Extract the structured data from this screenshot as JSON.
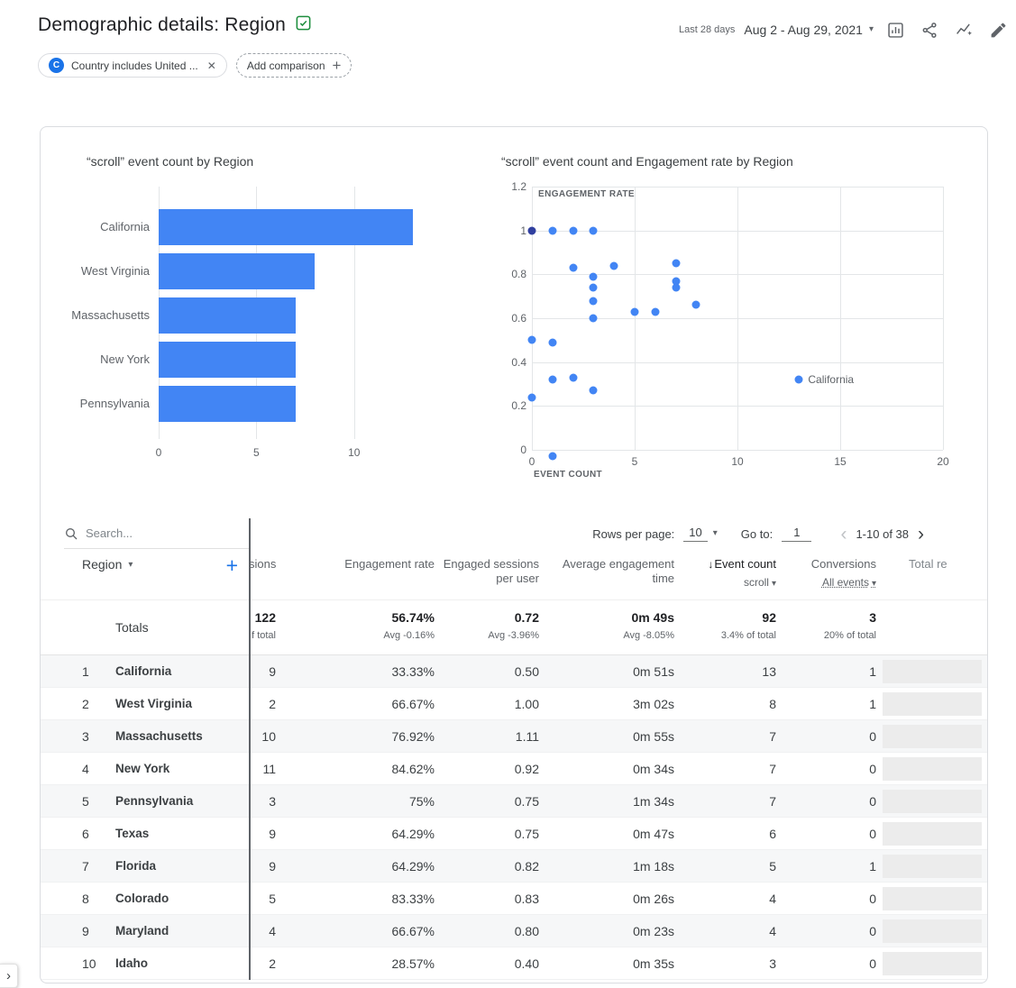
{
  "header": {
    "title": "Demographic details: Region",
    "date_range_label": "Last 28 days",
    "date_range": "Aug 2 - Aug 29, 2021"
  },
  "comparison": {
    "chip_badge": "C",
    "chip_label": "Country includes United ...",
    "add_label": "Add comparison"
  },
  "glyphs": {
    "caret_down": "▾",
    "close": "✕",
    "plus": "+",
    "chevron_left": "‹",
    "chevron_right": "›",
    "sort_desc": "↓",
    "nav_expand": "›"
  },
  "chart_data": [
    {
      "type": "bar",
      "orientation": "horizontal",
      "title": "“scroll” event count by Region",
      "categories": [
        "California",
        "West Virginia",
        "Massachusetts",
        "New York",
        "Pennsylvania"
      ],
      "values": [
        13,
        8,
        7,
        7,
        7
      ],
      "x_ticks": [
        0,
        5,
        10
      ],
      "xlim": [
        0,
        14.3
      ],
      "bar_color": "#4285f4"
    },
    {
      "type": "scatter",
      "title": "“scroll” event count and Engagement rate by Region",
      "xlabel": "EVENT COUNT",
      "ylabel": "ENGAGEMENT RATE",
      "x_ticks": [
        0,
        5,
        10,
        15,
        20
      ],
      "y_ticks": [
        0,
        0.2,
        0.4,
        0.6,
        0.8,
        1,
        1.2
      ],
      "xlim": [
        0,
        20
      ],
      "ylim": [
        0,
        1.2
      ],
      "point_color": "#4285f4",
      "points": [
        {
          "x": 0,
          "y": 1.0,
          "color": "#303f9f"
        },
        {
          "x": 1,
          "y": 1.0
        },
        {
          "x": 2,
          "y": 1.0
        },
        {
          "x": 3,
          "y": 1.0
        },
        {
          "x": 2,
          "y": 0.83
        },
        {
          "x": 4,
          "y": 0.84
        },
        {
          "x": 3,
          "y": 0.79
        },
        {
          "x": 3,
          "y": 0.74
        },
        {
          "x": 3,
          "y": 0.68
        },
        {
          "x": 3,
          "y": 0.6
        },
        {
          "x": 5,
          "y": 0.63
        },
        {
          "x": 6,
          "y": 0.63
        },
        {
          "x": 7,
          "y": 0.85
        },
        {
          "x": 7,
          "y": 0.77
        },
        {
          "x": 7,
          "y": 0.74
        },
        {
          "x": 8,
          "y": 0.66
        },
        {
          "x": 0,
          "y": 0.5
        },
        {
          "x": 1,
          "y": 0.49
        },
        {
          "x": 1,
          "y": 0.32
        },
        {
          "x": 2,
          "y": 0.33
        },
        {
          "x": 3,
          "y": 0.27
        },
        {
          "x": 0,
          "y": 0.24
        },
        {
          "x": 1,
          "y": -0.03
        },
        {
          "x": 13,
          "y": 0.32,
          "label": "California"
        }
      ]
    }
  ],
  "table": {
    "search_placeholder": "Search...",
    "rows_per_page_label": "Rows per page:",
    "rows_per_page_value": "10",
    "goto_label": "Go to:",
    "goto_value": "1",
    "page_range": "1-10 of 38",
    "dimension_header": "Region",
    "columns": [
      {
        "label": "sions"
      },
      {
        "label": "Engagement rate"
      },
      {
        "label": "Engaged sessions per user"
      },
      {
        "label": "Average engagement time"
      },
      {
        "label": "Event count",
        "sorted": true,
        "sub": "scroll"
      },
      {
        "label": "Conversions",
        "sub": "All events",
        "sub_underlined": true
      },
      {
        "label": "Total re"
      }
    ],
    "totals": {
      "label": "Totals",
      "values": [
        "122",
        "56.74%",
        "0.72",
        "0m 49s",
        "92",
        "3",
        ""
      ],
      "subs": [
        "f total",
        "Avg -0.16%",
        "Avg -3.96%",
        "Avg -8.05%",
        "3.4% of total",
        "20% of total",
        ""
      ]
    },
    "rows": [
      {
        "index": "1",
        "region": "California",
        "values": [
          "9",
          "33.33%",
          "0.50",
          "0m 51s",
          "13",
          "1"
        ]
      },
      {
        "index": "2",
        "region": "West Virginia",
        "values": [
          "2",
          "66.67%",
          "1.00",
          "3m 02s",
          "8",
          "1"
        ]
      },
      {
        "index": "3",
        "region": "Massachusetts",
        "values": [
          "10",
          "76.92%",
          "1.11",
          "0m 55s",
          "7",
          "0"
        ]
      },
      {
        "index": "4",
        "region": "New York",
        "values": [
          "11",
          "84.62%",
          "0.92",
          "0m 34s",
          "7",
          "0"
        ]
      },
      {
        "index": "5",
        "region": "Pennsylvania",
        "values": [
          "3",
          "75%",
          "0.75",
          "1m 34s",
          "7",
          "0"
        ]
      },
      {
        "index": "6",
        "region": "Texas",
        "values": [
          "9",
          "64.29%",
          "0.75",
          "0m 47s",
          "6",
          "0"
        ]
      },
      {
        "index": "7",
        "region": "Florida",
        "values": [
          "9",
          "64.29%",
          "0.82",
          "1m 18s",
          "5",
          "1"
        ]
      },
      {
        "index": "8",
        "region": "Colorado",
        "values": [
          "5",
          "83.33%",
          "0.83",
          "0m 26s",
          "4",
          "0"
        ]
      },
      {
        "index": "9",
        "region": "Maryland",
        "values": [
          "4",
          "66.67%",
          "0.80",
          "0m 23s",
          "4",
          "0"
        ]
      },
      {
        "index": "10",
        "region": "Idaho",
        "values": [
          "2",
          "28.57%",
          "0.40",
          "0m 35s",
          "3",
          "0"
        ]
      }
    ]
  }
}
